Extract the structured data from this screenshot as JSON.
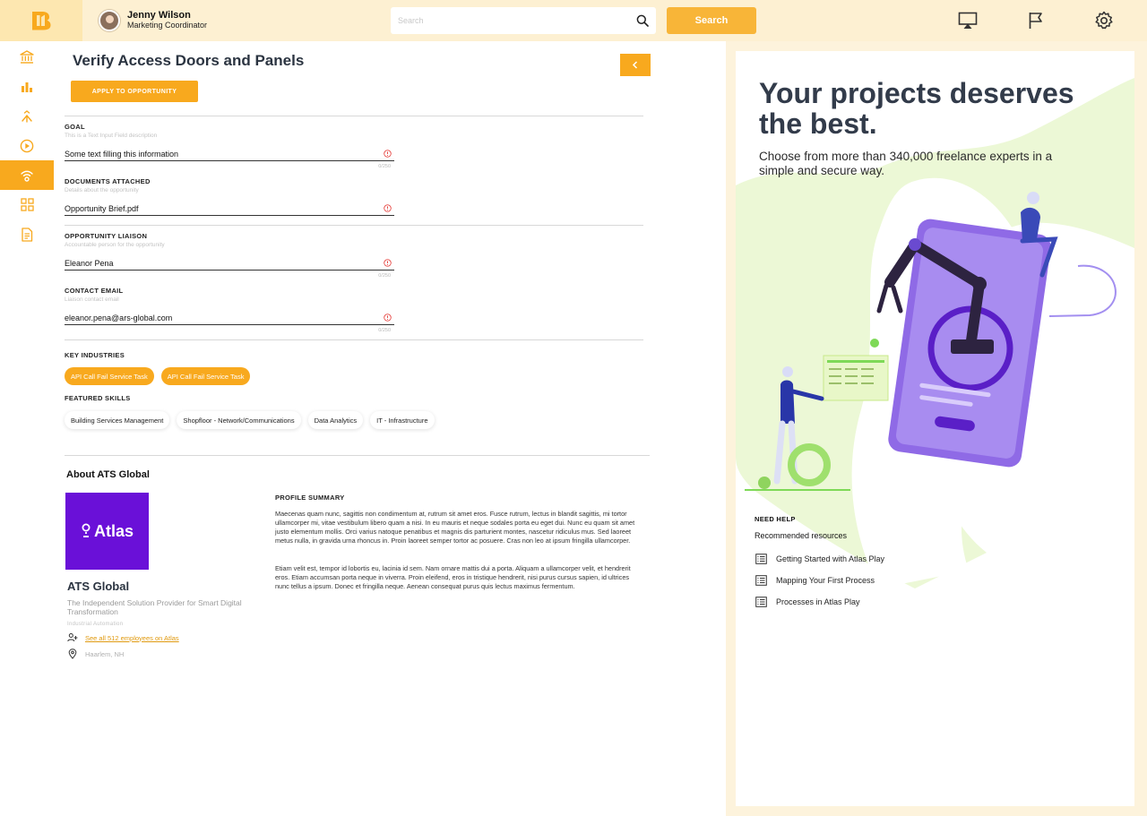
{
  "app": {
    "logo_icon": "brand-logo-icon"
  },
  "user": {
    "name": "Jenny Wilson",
    "role": "Marketing Coordinator"
  },
  "search": {
    "placeholder": "Search",
    "button_label": "Search"
  },
  "sidebar": {
    "items": [
      {
        "icon": "bank-icon",
        "active": false
      },
      {
        "icon": "bar-chart-icon",
        "active": false
      },
      {
        "icon": "merge-icon",
        "active": false
      },
      {
        "icon": "play-circle-icon",
        "active": false
      },
      {
        "icon": "broadcast-icon",
        "active": true
      },
      {
        "icon": "grid-icon",
        "active": false
      },
      {
        "icon": "document-icon",
        "active": false
      }
    ]
  },
  "page": {
    "title": "Verify Access Doors and Panels",
    "apply_label": "APPLY TO OPPORTUNITY",
    "collapse_icon": "chevron-left-icon"
  },
  "form": {
    "fields": [
      {
        "label": "GOAL",
        "description": "This is a Text Input Field description",
        "value": "Some text filling this information",
        "counter": "0/250"
      },
      {
        "label": "DOCUMENTS ATTACHED",
        "description": "Details about the opportunity",
        "value": "Opportunity Brief.pdf",
        "counter": ""
      },
      {
        "label": "OPPORTUNITY LIAISON",
        "description": "Accountable person for the opportunity",
        "value": "Eleanor Pena",
        "counter": "0/250"
      },
      {
        "label": "CONTACT EMAIL",
        "description": "Liaison contact email",
        "value": "eleanor.pena@ars-global.com",
        "counter": "0/250"
      }
    ],
    "key_industries_label": "KEY INDUSTRIES",
    "key_industries": [
      "API Call Fail Service Task",
      "API Call Fail Service Task"
    ],
    "featured_skills_label": "FEATURED SKILLS",
    "featured_skills": [
      "Building Services Management",
      "Shopfloor - Network/Communications",
      "Data Analytics",
      "IT - Infrastructure"
    ]
  },
  "about": {
    "title": "About ATS Global",
    "logo_text": "Atlas",
    "company_name": "ATS Global",
    "tagline": "The Independent Solution Provider for Smart Digital Transformation",
    "industry": "Industrial Automation",
    "employees_link": "See all 512 employees on Atlas",
    "location": "Haarlem, NH",
    "profile_title": "PROFILE SUMMARY",
    "profile_p1": "Maecenas quam nunc, sagittis non condimentum at, rutrum sit amet eros. Fusce rutrum, lectus in blandit sagittis, mi tortor ullamcorper mi, vitae vestibulum libero quam a nisi. In eu mauris et neque sodales porta eu eget dui. Nunc eu quam sit amet justo elementum mollis. Orci varius natoque penatibus et magnis dis parturient montes, nascetur ridiculus mus. Sed laoreet metus nulla, in gravida urna rhoncus in. Proin laoreet semper tortor ac posuere. Cras non leo at ipsum fringilla ullamcorper.",
    "profile_p2": "Etiam velit est, tempor id lobortis eu, lacinia id sem. Nam ornare mattis dui a porta. Aliquam a ullamcorper velit, et hendrerit eros. Etiam accumsan porta neque in viverra. Proin eleifend, eros in tristique hendrerit, nisi purus cursus sapien, id ultrices nunc tellus a ipsum. Donec et fringilla neque. Aenean consequat purus quis lectus maximus fermentum."
  },
  "hero": {
    "title": "Your projects deserves the best.",
    "subtitle": "Choose from more than 340,000 freelance experts in a simple and secure way."
  },
  "help": {
    "label": "NEED HELP",
    "subtitle": "Recommended resources",
    "resources": [
      "Getting Started with Atlas Play",
      "Mapping Your First Process",
      "Processes in Atlas Play"
    ]
  },
  "colors": {
    "accent": "#f8a91e",
    "topbar": "#fdf0d2",
    "brand_purple": "#6a10d8",
    "hero_green": "#ecf8d6"
  }
}
